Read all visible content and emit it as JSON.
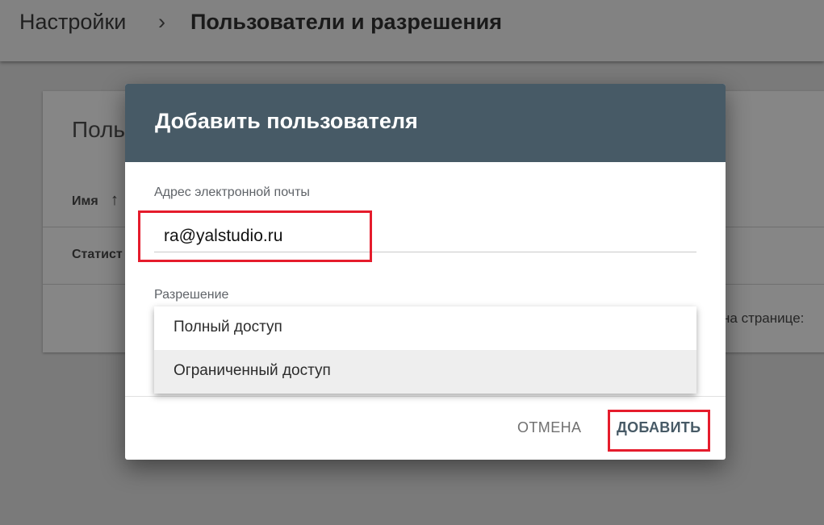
{
  "breadcrumb": {
    "parent": "Настройки",
    "separator": "›",
    "current": "Пользователи и разрешения"
  },
  "background_card": {
    "title": "Поль",
    "column_header": "Имя",
    "sort_icon": "↑",
    "row_label": "Статист",
    "per_page_text": "на странице:"
  },
  "dialog": {
    "title": "Добавить пользователя",
    "email": {
      "label": "Адрес электронной почты",
      "value": "ra@yalstudio.ru"
    },
    "permission": {
      "label": "Разрешение",
      "options": [
        "Полный доступ",
        "Ограниченный доступ"
      ]
    },
    "actions": {
      "cancel": "ОТМЕНА",
      "add": "ДОБАВИТЬ"
    }
  },
  "colors": {
    "dialog_header": "#475a66",
    "highlight": "#e51c2c"
  }
}
